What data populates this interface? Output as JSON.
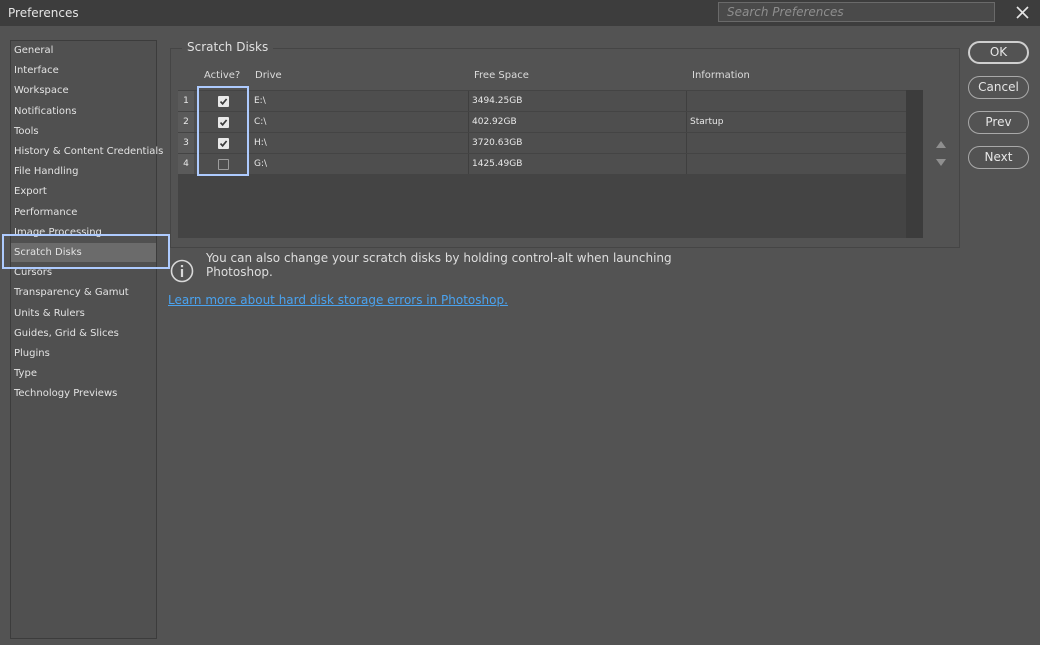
{
  "window": {
    "title": "Preferences"
  },
  "search": {
    "placeholder": "Search Preferences"
  },
  "sidebar": {
    "items": [
      {
        "label": "General"
      },
      {
        "label": "Interface"
      },
      {
        "label": "Workspace"
      },
      {
        "label": "Notifications"
      },
      {
        "label": "Tools"
      },
      {
        "label": "History & Content Credentials"
      },
      {
        "label": "File Handling"
      },
      {
        "label": "Export"
      },
      {
        "label": "Performance"
      },
      {
        "label": "Image Processing"
      },
      {
        "label": "Scratch Disks",
        "selected": true
      },
      {
        "label": "Cursors"
      },
      {
        "label": "Transparency & Gamut"
      },
      {
        "label": "Units & Rulers"
      },
      {
        "label": "Guides, Grid & Slices"
      },
      {
        "label": "Plugins"
      },
      {
        "label": "Type"
      },
      {
        "label": "Technology Previews"
      }
    ]
  },
  "scratch": {
    "title": "Scratch Disks",
    "headers": {
      "active": "Active?",
      "drive": "Drive",
      "free": "Free Space",
      "info": "Information"
    },
    "rows": [
      {
        "num": "1",
        "active": true,
        "drive": "E:\\",
        "free": "3494.25GB",
        "info": ""
      },
      {
        "num": "2",
        "active": true,
        "drive": "C:\\",
        "free": "402.92GB",
        "info": "Startup"
      },
      {
        "num": "3",
        "active": true,
        "drive": "H:\\",
        "free": "3720.63GB",
        "info": ""
      },
      {
        "num": "4",
        "active": false,
        "drive": "G:\\",
        "free": "1425.49GB",
        "info": ""
      }
    ],
    "note": "You can also change your scratch disks by holding control-alt when launching Photoshop.",
    "link": "Learn more about hard disk storage errors in Photoshop."
  },
  "buttons": {
    "ok": "OK",
    "cancel": "Cancel",
    "prev": "Prev",
    "next": "Next"
  },
  "icons": {
    "close": "close-icon",
    "move_up": "triangle-up-icon",
    "move_down": "triangle-down-icon",
    "info": "info-icon",
    "check": "checkmark-icon"
  },
  "colors": {
    "background": "#535353",
    "selection_outline": "#aecbff",
    "link": "#4aa3f0"
  }
}
